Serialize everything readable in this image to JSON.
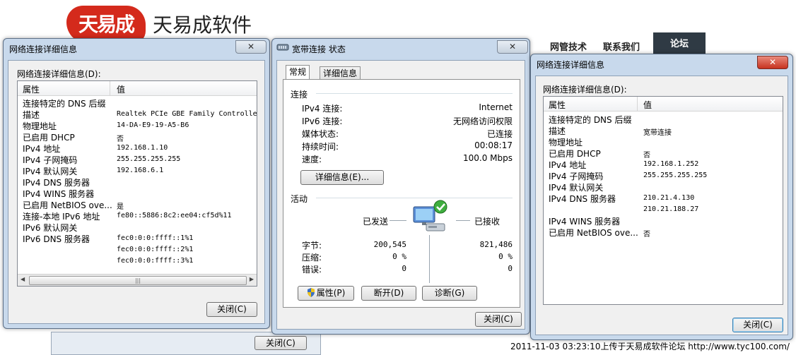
{
  "website": {
    "logo_badge": "天易成",
    "logo_text": "天易成软件",
    "nav": [
      "网管技术",
      "联系我们",
      "论坛"
    ],
    "back_close_label": "关闭(C)",
    "watermark": "2011-11-03 03:23:10上传于天易成软件论坛 http://www.tyc100.com/"
  },
  "left_dialog": {
    "title": "网络连接详细信息",
    "list_label": "网络连接详细信息(D):",
    "col_property": "属性",
    "col_value": "值",
    "rows": [
      {
        "property": "连接特定的 DNS 后缀",
        "value": ""
      },
      {
        "property": "描述",
        "value": "Realtek PCIe GBE Family Controlle"
      },
      {
        "property": "物理地址",
        "value": "14-DA-E9-19-A5-B6"
      },
      {
        "property": "已启用 DHCP",
        "value": "否"
      },
      {
        "property": "IPv4 地址",
        "value": "192.168.1.10"
      },
      {
        "property": "IPv4 子网掩码",
        "value": "255.255.255.255"
      },
      {
        "property": "IPv4 默认网关",
        "value": "192.168.6.1"
      },
      {
        "property": "IPv4 DNS 服务器",
        "value": ""
      },
      {
        "property": "IPv4 WINS 服务器",
        "value": ""
      },
      {
        "property": "已启用 NetBIOS ove...",
        "value": "是"
      },
      {
        "property": "连接-本地 IPv6 地址",
        "value": "fe80::5886:8c2:ee04:cf5d%11"
      },
      {
        "property": "IPv6 默认网关",
        "value": ""
      },
      {
        "property": "IPv6 DNS 服务器",
        "value": "fec0:0:0:ffff::1%1"
      },
      {
        "property": "",
        "value": "fec0:0:0:ffff::2%1"
      },
      {
        "property": "",
        "value": "fec0:0:0:ffff::3%1"
      }
    ],
    "close_label": "关闭(C)"
  },
  "status_dialog": {
    "title": "宽带连接 状态",
    "tabs": [
      "常规",
      "详细信息"
    ],
    "connection_heading": "连接",
    "connection_rows": [
      {
        "label": "IPv4 连接:",
        "value": "Internet"
      },
      {
        "label": "IPv6 连接:",
        "value": "无网络访问权限"
      },
      {
        "label": "媒体状态:",
        "value": "已连接"
      },
      {
        "label": "持续时间:",
        "value": "00:08:17"
      },
      {
        "label": "速度:",
        "value": "100.0 Mbps"
      }
    ],
    "details_button": "详细信息(E)...",
    "activity_heading": "活动",
    "sent_label": "已发送",
    "received_label": "已接收",
    "activity_rows": [
      {
        "label": "字节:",
        "sent": "200,545",
        "received": "821,486"
      },
      {
        "label": "压缩:",
        "sent": "0 %",
        "received": "0 %"
      },
      {
        "label": "错误:",
        "sent": "0",
        "received": "0"
      }
    ],
    "properties_button": "属性(P)",
    "disconnect_button": "断开(D)",
    "diagnose_button": "诊断(G)",
    "close_label": "关闭(C)"
  },
  "right_dialog": {
    "title": "网络连接详细信息",
    "list_label": "网络连接详细信息(D):",
    "col_property": "属性",
    "col_value": "值",
    "rows": [
      {
        "property": "连接特定的 DNS 后缀",
        "value": ""
      },
      {
        "property": "描述",
        "value": "宽带连接"
      },
      {
        "property": "物理地址",
        "value": ""
      },
      {
        "property": "已启用 DHCP",
        "value": "否"
      },
      {
        "property": "IPv4 地址",
        "value": "192.168.1.252"
      },
      {
        "property": "IPv4 子网掩码",
        "value": "255.255.255.255"
      },
      {
        "property": "IPv4 默认网关",
        "value": ""
      },
      {
        "property": "IPv4 DNS 服务器",
        "value": "210.21.4.130"
      },
      {
        "property": "",
        "value": "210.21.188.27"
      },
      {
        "property": "IPv4 WINS 服务器",
        "value": ""
      },
      {
        "property": "已启用 NetBIOS ove...",
        "value": "否"
      }
    ],
    "close_label": "关闭(C)"
  }
}
